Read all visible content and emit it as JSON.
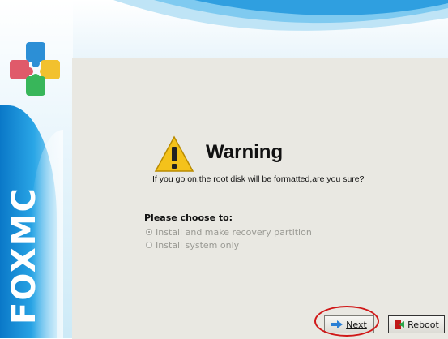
{
  "brand": {
    "logo_text": "FOXMC"
  },
  "warning": {
    "title": "Warning",
    "message": "If you go on,the root disk will be formatted,are you sure?"
  },
  "options": {
    "heading": "Please choose to:",
    "items": [
      {
        "label": "Install and make recovery partition",
        "selected": true
      },
      {
        "label": "Install system only",
        "selected": false
      }
    ]
  },
  "buttons": {
    "next_label": "Next",
    "reboot_label": "Reboot"
  },
  "colors": {
    "accent_blue": "#2aa6e6",
    "highlight_red": "#d01818",
    "panel_bg": "#e9e8e2"
  }
}
